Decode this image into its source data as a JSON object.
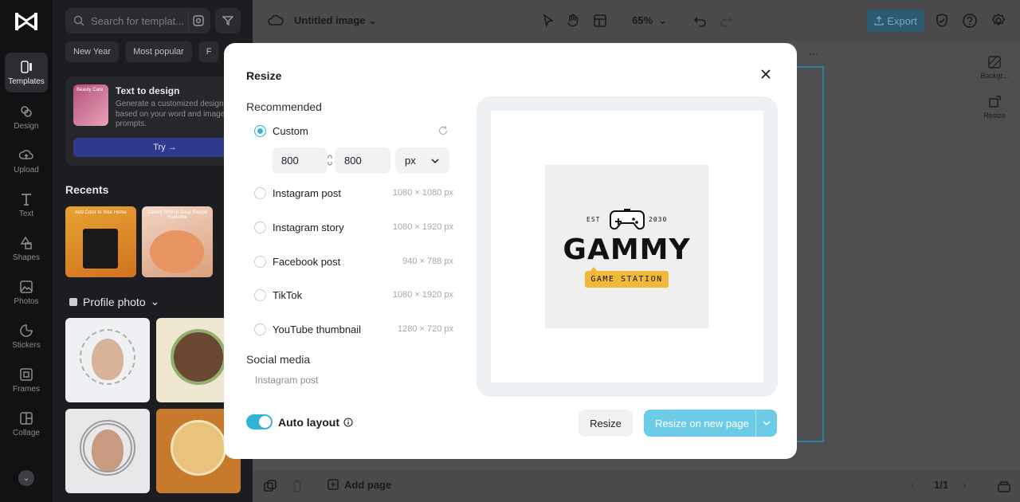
{
  "app": {
    "doc_title": "Untitled image",
    "zoom": "65%",
    "export_label": "Export",
    "search_placeholder": "Search for templat...",
    "chips": [
      "New Year",
      "Most popular",
      "F"
    ],
    "text_to_design": {
      "title": "Text to design",
      "description": "Generate a customized design based on your word and image prompts.",
      "try_label": "Try →",
      "thumb_text": "Beauty Care"
    },
    "recents_title": "Recents",
    "recents": [
      "Add Color to Your Home",
      "Savory Shrimp Soup Recipe Supreme"
    ],
    "profile_title": "Profile photo",
    "rail": [
      "Templates",
      "Design",
      "Upload",
      "Text",
      "Shapes",
      "Photos",
      "Stickers",
      "Frames",
      "Collage"
    ],
    "right_tools": [
      "Backgr...",
      "Resize"
    ],
    "add_page_label": "Add page",
    "page_counter": "1/1"
  },
  "modal": {
    "title": "Resize",
    "recommended_label": "Recommended",
    "custom": {
      "label": "Custom",
      "width": "800",
      "height": "800",
      "unit": "px",
      "selected": true
    },
    "presets": [
      {
        "label": "Instagram post",
        "dims": "1080 × 1080 px"
      },
      {
        "label": "Instagram story",
        "dims": "1080 × 1920 px"
      },
      {
        "label": "Facebook post",
        "dims": "940 × 788 px"
      },
      {
        "label": "TikTok",
        "dims": "1080 × 1920 px"
      },
      {
        "label": "YouTube thumbnail",
        "dims": "1280 × 720 px"
      }
    ],
    "social_media_label": "Social media",
    "social_media_items": [
      "Instagram post"
    ],
    "auto_layout_label": "Auto layout",
    "auto_layout_on": true,
    "resize_button": "Resize",
    "resize_new_page_button": "Resize on new page"
  },
  "preview": {
    "est_left": "EST",
    "est_right": "2030",
    "brand": "GAMMY",
    "tagline": "GAME STATION"
  },
  "colors": {
    "accent": "#34b3d8",
    "primary_button": "#6ccbe6",
    "tag_yellow": "#f0b93a"
  }
}
